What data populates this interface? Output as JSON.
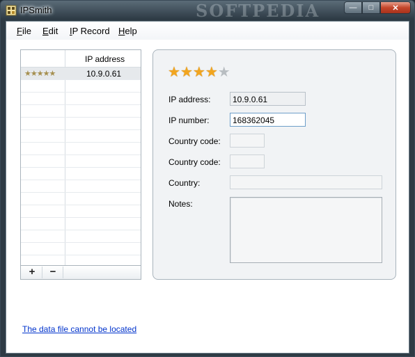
{
  "window": {
    "title": "IPSmith",
    "watermark": "SOFTPEDIA"
  },
  "caption_buttons": {
    "min": "—",
    "max": "□",
    "close": "✕"
  },
  "menu": [
    {
      "label": "File",
      "underline": "F",
      "rest": "ile"
    },
    {
      "label": "Edit",
      "underline": "E",
      "rest": "dit"
    },
    {
      "label": "IP Record",
      "underline": "I",
      "rest": "P Record"
    },
    {
      "label": "Help",
      "underline": "H",
      "rest": "elp"
    }
  ],
  "list": {
    "header": "IP address",
    "rows": [
      {
        "stars": "★★★★★",
        "ip": "10.9.0.61"
      }
    ],
    "add_label": "+",
    "remove_label": "−"
  },
  "detail": {
    "rating": {
      "value": 4,
      "max": 5,
      "glyph": "★"
    },
    "ip_address_label": "IP address:",
    "ip_address_value": "10.9.0.61",
    "ip_number_label": "IP number:",
    "ip_number_value": "168362045",
    "country_code_label_1": "Country code:",
    "country_code_value_1": "",
    "country_code_label_2": "Country code:",
    "country_code_value_2": "",
    "country_label": "Country:",
    "country_value": "",
    "notes_label": "Notes:",
    "notes_value": ""
  },
  "status": {
    "link_text": "The data file cannot be located"
  },
  "colors": {
    "accent_link": "#0033cc",
    "star_on": "#f2a51e",
    "star_off": "#b8bdc1",
    "close_button": "#c4462b"
  },
  "icons": {
    "app": "ipsmith-app-icon"
  }
}
